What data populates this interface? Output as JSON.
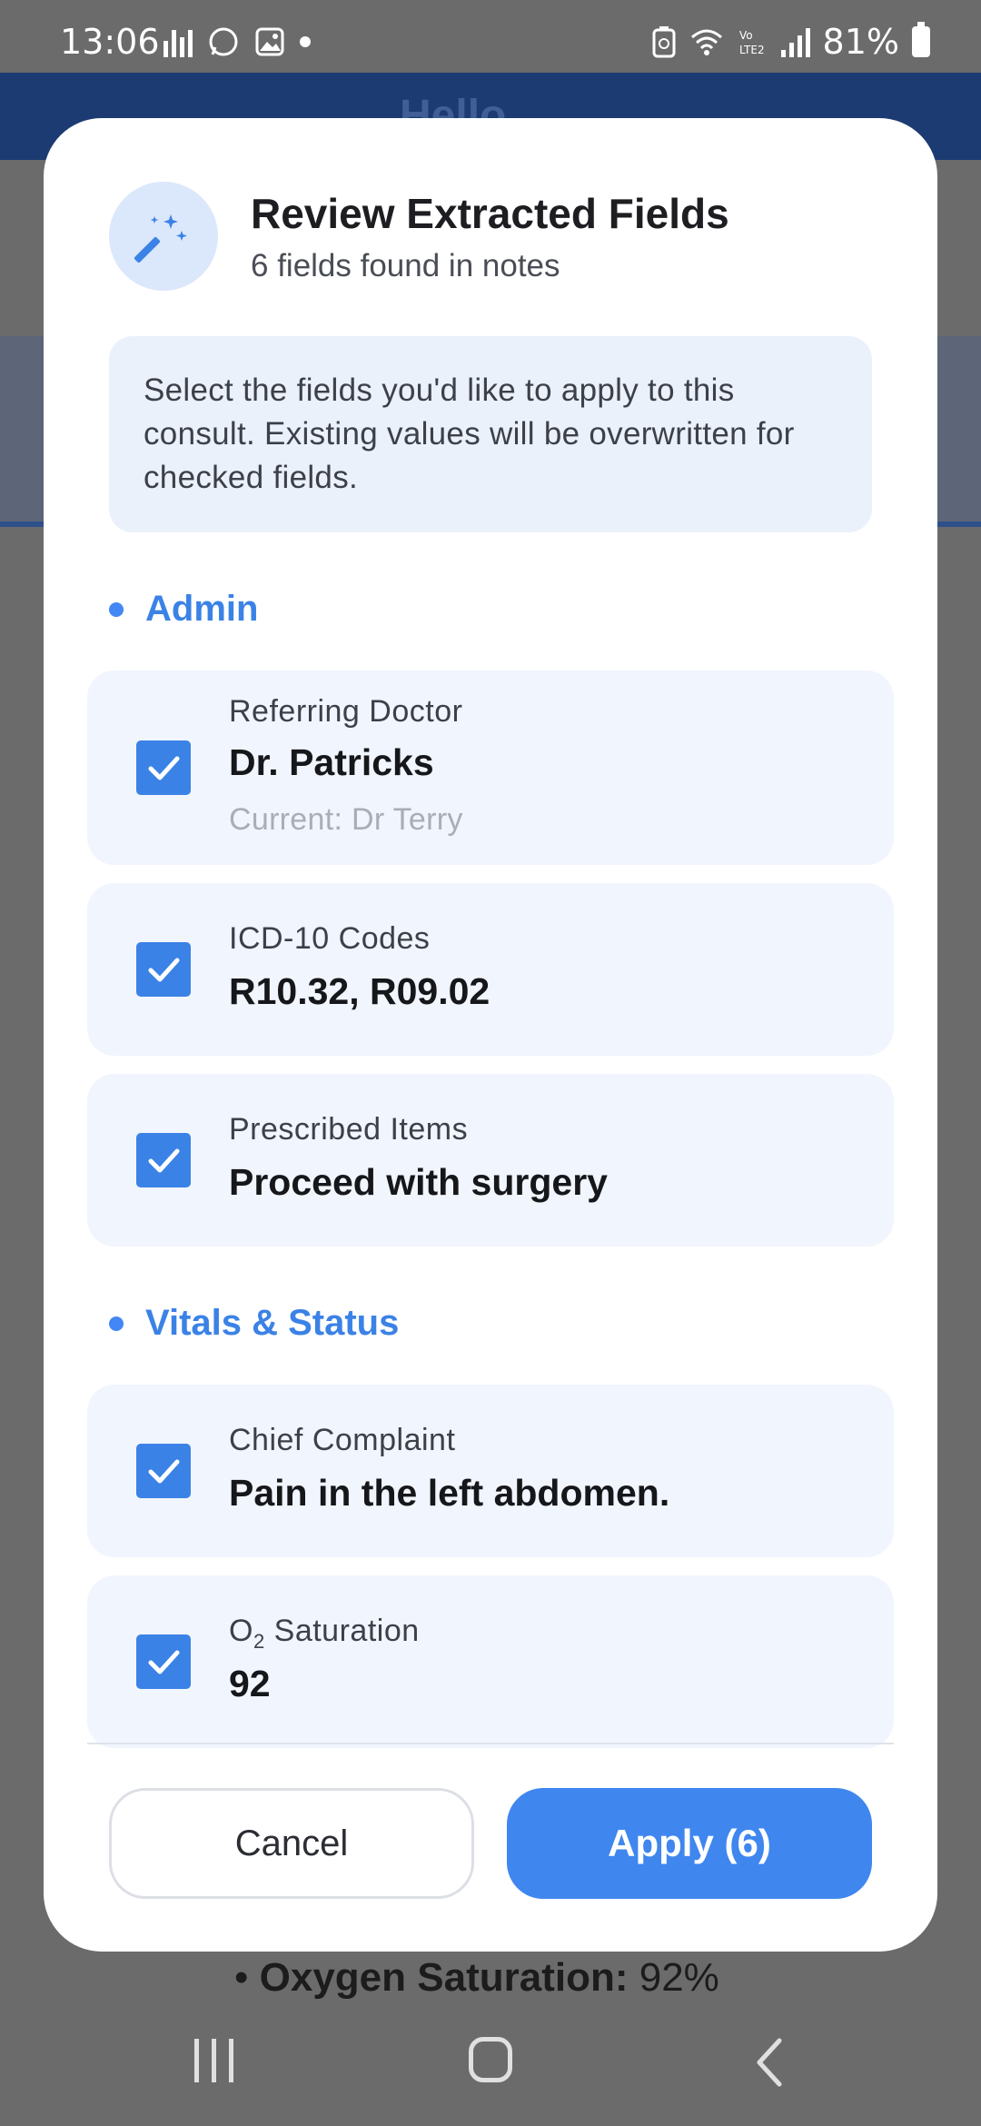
{
  "status_bar": {
    "time": "13:06",
    "battery": "81%",
    "icons": [
      "signal-bars-icon",
      "whatsapp-icon",
      "gallery-icon",
      "dot-icon",
      "battery-saver-icon",
      "wifi-icon",
      "volte-icon",
      "cell-signal-icon",
      "battery-icon"
    ]
  },
  "background": {
    "header_title": "Hello",
    "bullet_label": "Oxygen Saturation:",
    "bullet_value": "92%"
  },
  "dialog": {
    "title": "Review Extracted Fields",
    "subtitle": "6 fields found in notes",
    "icon": "magic-wand-icon",
    "info": "Select the fields you'd like to apply to this consult. Existing values will be overwritten for checked fields.",
    "sections": [
      {
        "label": "Admin",
        "fields": [
          {
            "label": "Referring Doctor",
            "value": "Dr. Patricks",
            "current": "Current: Dr Terry",
            "checked": true
          },
          {
            "label": "ICD-10 Codes",
            "value": "R10.32, R09.02",
            "checked": true
          },
          {
            "label": "Prescribed Items",
            "value": "Proceed with surgery",
            "checked": true
          }
        ]
      },
      {
        "label": "Vitals & Status",
        "fields": [
          {
            "label": "Chief Complaint",
            "value": "Pain in the left abdomen.",
            "checked": true
          },
          {
            "label_prefix": "O",
            "label_sub": "2",
            "label_suffix": " Saturation",
            "value": "92",
            "checked": true
          }
        ]
      }
    ],
    "cancel_label": "Cancel",
    "apply_label": "Apply (6)"
  },
  "colors": {
    "accent": "#3f86ef",
    "section_label": "#3b82e6",
    "field_bg": "#f1f5fd",
    "info_bg": "#eaf1fb",
    "scrim": "#6b6b6b"
  }
}
